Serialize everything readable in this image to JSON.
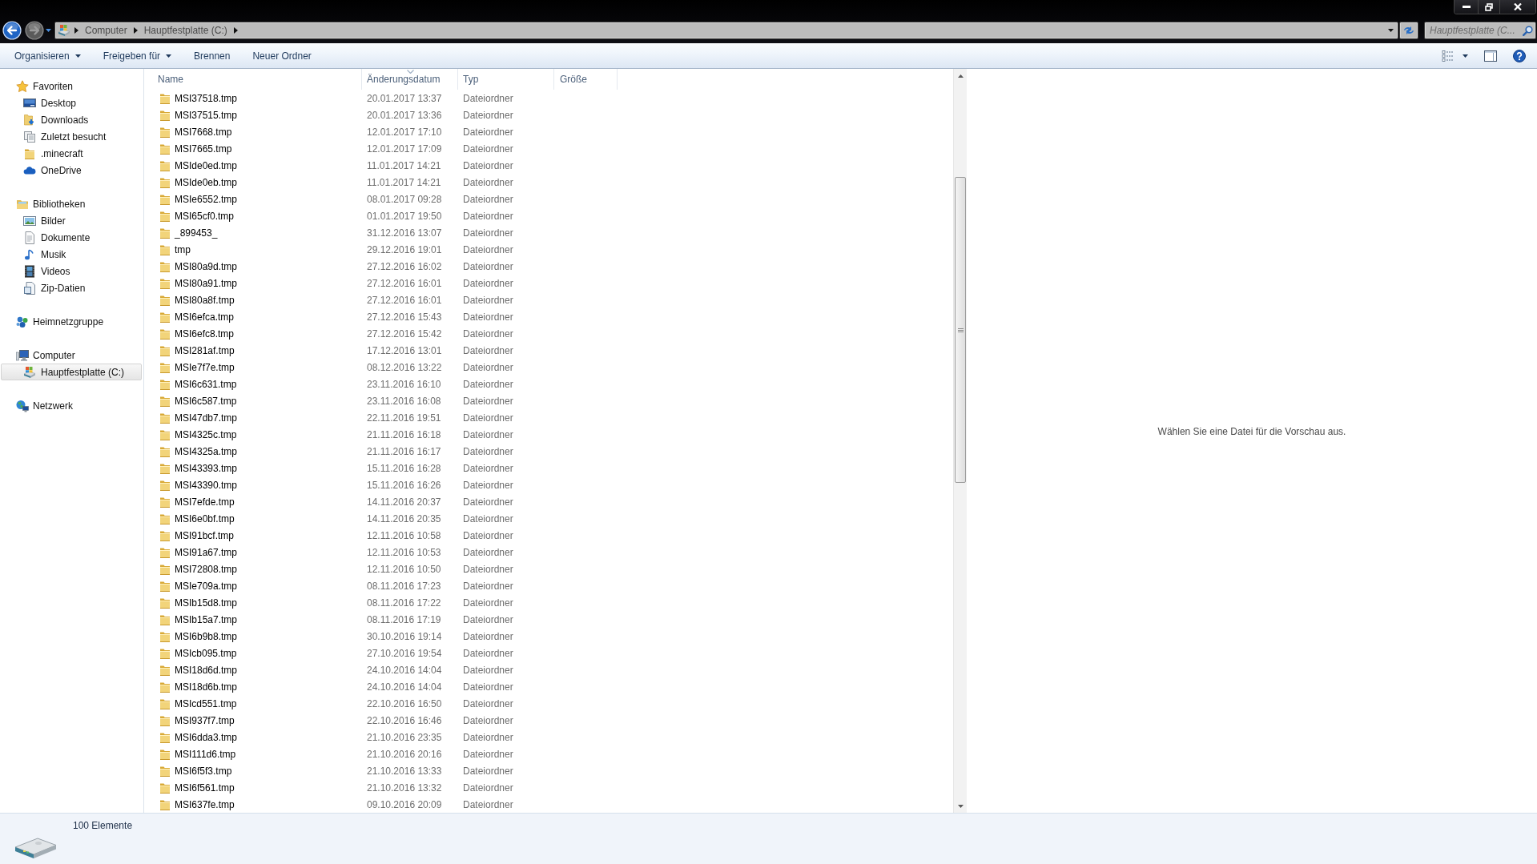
{
  "navigation": {
    "back": {
      "disabled": false
    },
    "forward": {
      "disabled": true
    }
  },
  "address_bar": {
    "path": [
      "Computer",
      "Hauptfestplatte (C:)"
    ]
  },
  "search": {
    "placeholder": "Hauptfestplatte (C..."
  },
  "toolbar": {
    "buttons": [
      {
        "label": "Organisieren",
        "dropdown": true
      },
      {
        "label": "Freigeben für",
        "dropdown": true
      },
      {
        "label": "Brennen",
        "dropdown": false
      },
      {
        "label": "Neuer Ordner",
        "dropdown": false
      }
    ]
  },
  "sidebar": {
    "items": [
      {
        "label": "Favoriten",
        "selected": false,
        "children": [
          {
            "label": "Desktop",
            "selected": false
          },
          {
            "label": "Downloads",
            "selected": false
          },
          {
            "label": "Zuletzt besucht",
            "selected": false
          },
          {
            "label": ".minecraft",
            "selected": false
          },
          {
            "label": "OneDrive",
            "selected": false
          }
        ]
      },
      {
        "label": "Bibliotheken",
        "selected": false,
        "children": [
          {
            "label": "Bilder",
            "selected": false
          },
          {
            "label": "Dokumente",
            "selected": false
          },
          {
            "label": "Musik",
            "selected": false
          },
          {
            "label": "Videos",
            "selected": false
          },
          {
            "label": "Zip-Datien",
            "selected": false
          }
        ]
      },
      {
        "label": "Heimnetzgruppe",
        "selected": false
      },
      {
        "label": "Computer",
        "selected": false,
        "children": [
          {
            "label": "Hauptfestplatte (C:)",
            "selected": true
          }
        ]
      },
      {
        "label": "Netzwerk",
        "selected": false
      }
    ]
  },
  "table": {
    "columns": [
      {
        "label": "Name",
        "sorted": false
      },
      {
        "label": "Änderungsdatum",
        "sorted": true
      },
      {
        "label": "Typ",
        "sorted": false
      },
      {
        "label": "Größe",
        "sorted": false
      }
    ],
    "rows": [
      {
        "name": "MSI37518.tmp",
        "modified": "20.01.2017 13:37",
        "type": "Dateiordner",
        "selected": false
      },
      {
        "name": "MSI37515.tmp",
        "modified": "20.01.2017 13:36",
        "type": "Dateiordner",
        "selected": false
      },
      {
        "name": "MSI7668.tmp",
        "modified": "12.01.2017 17:10",
        "type": "Dateiordner",
        "selected": false
      },
      {
        "name": "MSI7665.tmp",
        "modified": "12.01.2017 17:09",
        "type": "Dateiordner",
        "selected": false
      },
      {
        "name": "MSIde0ed.tmp",
        "modified": "11.01.2017 14:21",
        "type": "Dateiordner",
        "selected": false
      },
      {
        "name": "MSIde0eb.tmp",
        "modified": "11.01.2017 14:21",
        "type": "Dateiordner",
        "selected": false
      },
      {
        "name": "MSIe6552.tmp",
        "modified": "08.01.2017 09:28",
        "type": "Dateiordner",
        "selected": false
      },
      {
        "name": "MSI65cf0.tmp",
        "modified": "01.01.2017 19:50",
        "type": "Dateiordner",
        "selected": false
      },
      {
        "name": "_899453_",
        "modified": "31.12.2016 13:07",
        "type": "Dateiordner",
        "selected": false
      },
      {
        "name": "tmp",
        "modified": "29.12.2016 19:01",
        "type": "Dateiordner",
        "selected": false
      },
      {
        "name": "MSI80a9d.tmp",
        "modified": "27.12.2016 16:02",
        "type": "Dateiordner",
        "selected": false
      },
      {
        "name": "MSI80a91.tmp",
        "modified": "27.12.2016 16:01",
        "type": "Dateiordner",
        "selected": false
      },
      {
        "name": "MSI80a8f.tmp",
        "modified": "27.12.2016 16:01",
        "type": "Dateiordner",
        "selected": false
      },
      {
        "name": "MSI6efca.tmp",
        "modified": "27.12.2016 15:43",
        "type": "Dateiordner",
        "selected": false
      },
      {
        "name": "MSI6efc8.tmp",
        "modified": "27.12.2016 15:42",
        "type": "Dateiordner",
        "selected": false
      },
      {
        "name": "MSI281af.tmp",
        "modified": "17.12.2016 13:01",
        "type": "Dateiordner",
        "selected": false
      },
      {
        "name": "MSIe7f7e.tmp",
        "modified": "08.12.2016 13:22",
        "type": "Dateiordner",
        "selected": false
      },
      {
        "name": "MSI6c631.tmp",
        "modified": "23.11.2016 16:10",
        "type": "Dateiordner",
        "selected": false
      },
      {
        "name": "MSI6c587.tmp",
        "modified": "23.11.2016 16:08",
        "type": "Dateiordner",
        "selected": false
      },
      {
        "name": "MSI47db7.tmp",
        "modified": "22.11.2016 19:51",
        "type": "Dateiordner",
        "selected": false
      },
      {
        "name": "MSI4325c.tmp",
        "modified": "21.11.2016 16:18",
        "type": "Dateiordner",
        "selected": false
      },
      {
        "name": "MSI4325a.tmp",
        "modified": "21.11.2016 16:17",
        "type": "Dateiordner",
        "selected": false
      },
      {
        "name": "MSI43393.tmp",
        "modified": "15.11.2016 16:28",
        "type": "Dateiordner",
        "selected": false
      },
      {
        "name": "MSI43390.tmp",
        "modified": "15.11.2016 16:26",
        "type": "Dateiordner",
        "selected": false
      },
      {
        "name": "MSI7efde.tmp",
        "modified": "14.11.2016 20:37",
        "type": "Dateiordner",
        "selected": false
      },
      {
        "name": "MSI6e0bf.tmp",
        "modified": "14.11.2016 20:35",
        "type": "Dateiordner",
        "selected": false
      },
      {
        "name": "MSI91bcf.tmp",
        "modified": "12.11.2016 10:58",
        "type": "Dateiordner",
        "selected": false
      },
      {
        "name": "MSI91a67.tmp",
        "modified": "12.11.2016 10:53",
        "type": "Dateiordner",
        "selected": false
      },
      {
        "name": "MSI72808.tmp",
        "modified": "12.11.2016 10:50",
        "type": "Dateiordner",
        "selected": false
      },
      {
        "name": "MSIe709a.tmp",
        "modified": "08.11.2016 17:23",
        "type": "Dateiordner",
        "selected": false
      },
      {
        "name": "MSIb15d8.tmp",
        "modified": "08.11.2016 17:22",
        "type": "Dateiordner",
        "selected": false
      },
      {
        "name": "MSIb15a7.tmp",
        "modified": "08.11.2016 17:19",
        "type": "Dateiordner",
        "selected": false
      },
      {
        "name": "MSI6b9b8.tmp",
        "modified": "30.10.2016 19:14",
        "type": "Dateiordner",
        "selected": false
      },
      {
        "name": "MSIcb095.tmp",
        "modified": "27.10.2016 19:54",
        "type": "Dateiordner",
        "selected": false
      },
      {
        "name": "MSI18d6d.tmp",
        "modified": "24.10.2016 14:04",
        "type": "Dateiordner",
        "selected": false
      },
      {
        "name": "MSI18d6b.tmp",
        "modified": "24.10.2016 14:04",
        "type": "Dateiordner",
        "selected": false
      },
      {
        "name": "MSIcd551.tmp",
        "modified": "22.10.2016 16:50",
        "type": "Dateiordner",
        "selected": false
      },
      {
        "name": "MSI937f7.tmp",
        "modified": "22.10.2016 16:46",
        "type": "Dateiordner",
        "selected": false
      },
      {
        "name": "MSI6dda3.tmp",
        "modified": "21.10.2016 23:35",
        "type": "Dateiordner",
        "selected": false
      },
      {
        "name": "MSI111d6.tmp",
        "modified": "21.10.2016 20:16",
        "type": "Dateiordner",
        "selected": false
      },
      {
        "name": "MSI6f5f3.tmp",
        "modified": "21.10.2016 13:33",
        "type": "Dateiordner",
        "selected": false
      },
      {
        "name": "MSI6f561.tmp",
        "modified": "21.10.2016 13:32",
        "type": "Dateiordner",
        "selected": false
      },
      {
        "name": "MSI637fe.tmp",
        "modified": "09.10.2016 20:09",
        "type": "Dateiordner",
        "selected": false
      }
    ]
  },
  "preview": {
    "message": "Wählen Sie eine Datei für die Vorschau aus."
  },
  "status_bar": {
    "count": "100 Elemente"
  }
}
